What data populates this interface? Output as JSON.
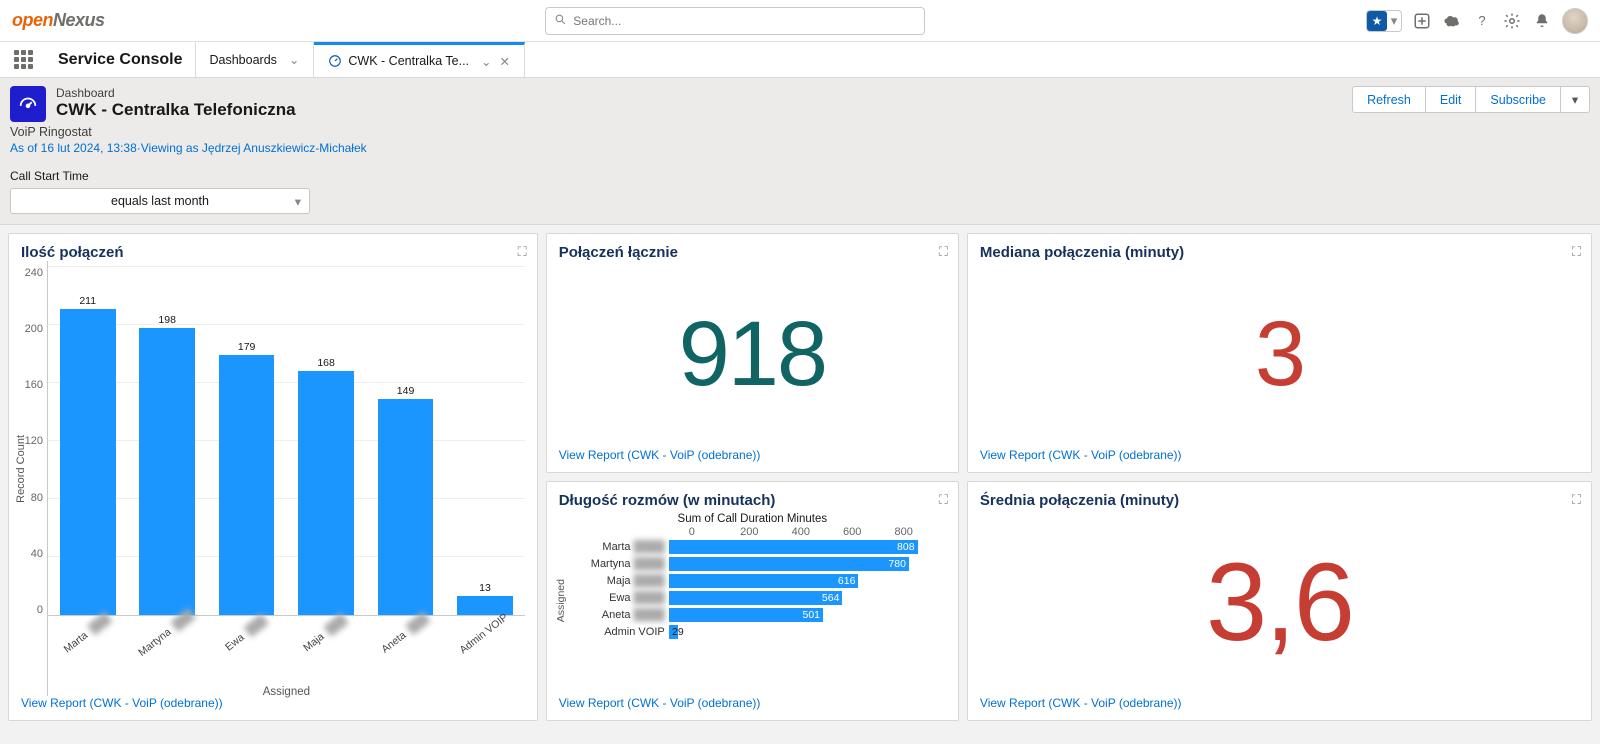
{
  "brand": {
    "open": "open",
    "nexus": "Nexus"
  },
  "search": {
    "placeholder": "Search..."
  },
  "app_name": "Service Console",
  "tabs": [
    {
      "label": "Dashboards",
      "active": false
    },
    {
      "label": "CWK - Centralka Te...",
      "active": true
    }
  ],
  "page": {
    "object_type": "Dashboard",
    "title": "CWK - Centralka Telefoniczna",
    "subtitle": "VoiP Ringostat",
    "as_of": "As of 16 lut 2024, 13:38·Viewing as Jędrzej Anuszkiewicz-Michałek",
    "filter_label": "Call Start Time",
    "filter_value": "equals last month",
    "actions": {
      "refresh": "Refresh",
      "edit": "Edit",
      "subscribe": "Subscribe"
    }
  },
  "cards": {
    "polaczen": {
      "title": "Połączeń łącznie",
      "value": "918",
      "link": "View Report (CWK - VoiP (odebrane))"
    },
    "mediana": {
      "title": "Mediana połączenia (minuty)",
      "value": "3",
      "link": "View Report (CWK - VoiP (odebrane))"
    },
    "srednia": {
      "title": "Średnia połączenia (minuty)",
      "value": "3,6",
      "link": "View Report (CWK - VoiP (odebrane))"
    },
    "dlugosc": {
      "title": "Długość rozmów (w minutach)",
      "link": "View Report (CWK - VoiP (odebrane))"
    },
    "ilosc": {
      "title": "Ilość połączeń",
      "link": "View Report (CWK - VoiP (odebrane))"
    }
  },
  "chart_data": [
    {
      "id": "dlugosc",
      "type": "bar",
      "orientation": "horizontal",
      "title": "Sum of Call Duration Minutes",
      "ylabel": "Assigned",
      "x_ticks": [
        0,
        200,
        400,
        600,
        800
      ],
      "xmax": 900,
      "categories": [
        "Marta",
        "Martyna",
        "Maja",
        "Ewa",
        "Aneta",
        "Admin VOIP"
      ],
      "values": [
        808,
        780,
        616,
        564,
        501,
        29
      ]
    },
    {
      "id": "ilosc",
      "type": "bar",
      "orientation": "vertical",
      "ylabel": "Record Count",
      "xlabel": "Assigned",
      "y_ticks": [
        0,
        40,
        80,
        120,
        160,
        200,
        240
      ],
      "ymax": 240,
      "categories": [
        "Marta",
        "Martyna",
        "Ewa",
        "Maja",
        "Aneta",
        "Admin VOIP"
      ],
      "values": [
        211,
        198,
        179,
        168,
        149,
        13
      ]
    }
  ]
}
